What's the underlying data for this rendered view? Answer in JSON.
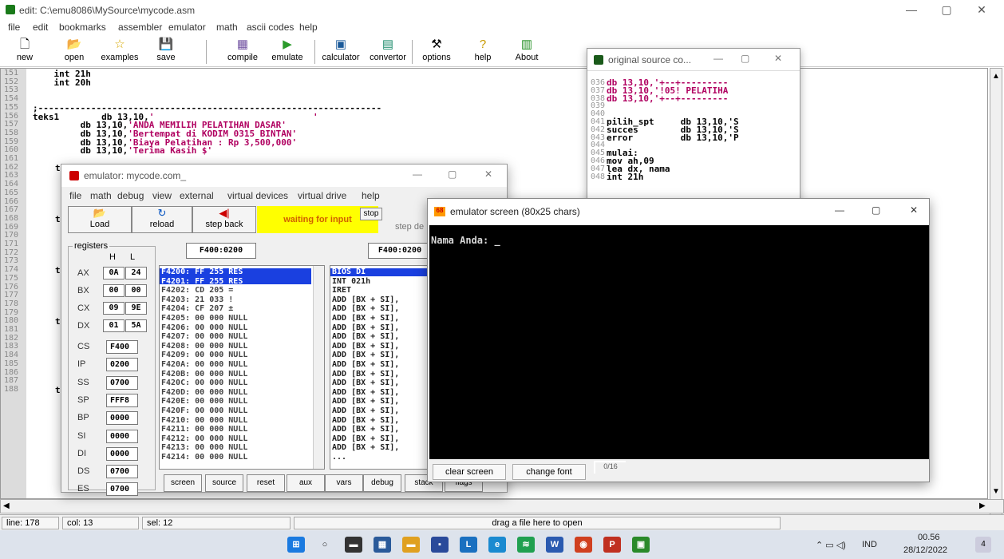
{
  "main_window": {
    "title": "edit: C:\\emu8086\\MySource\\mycode.asm",
    "controls": {
      "min": "—",
      "max": "▢",
      "close": "✕"
    }
  },
  "menu": [
    "file",
    "edit",
    "bookmarks",
    "assembler",
    "emulator",
    "math",
    "ascii codes",
    "help"
  ],
  "toolbar": [
    {
      "label": "new",
      "icon": "🗋"
    },
    {
      "label": "open",
      "icon": "📂"
    },
    {
      "label": "examples",
      "icon": "☆"
    },
    {
      "label": "save",
      "icon": "💾"
    },
    {
      "label": "compile",
      "icon": "▦"
    },
    {
      "label": "emulate",
      "icon": "▶"
    },
    {
      "label": "calculator",
      "icon": "▣"
    },
    {
      "label": "convertor",
      "icon": "▤"
    },
    {
      "label": "options",
      "icon": "⚒"
    },
    {
      "label": "help",
      "icon": "?"
    },
    {
      "label": "About",
      "icon": "▥"
    }
  ],
  "editor": {
    "line_numbers": [
      "151",
      "152",
      "153",
      "154",
      "155",
      "156",
      "157",
      "158",
      "159",
      "160",
      "161",
      "162",
      "163",
      "164",
      "165",
      "166",
      "167",
      "168",
      "169",
      "170",
      "171",
      "172",
      "173",
      "174",
      "175",
      "176",
      "177",
      "178",
      "179",
      "180",
      "181",
      "182",
      "183",
      "184",
      "185",
      "186",
      "187",
      "188"
    ],
    "lines": [
      {
        "text": "    int 21h",
        "str": ""
      },
      {
        "text": "    int 20h",
        "str": ""
      },
      {
        "text": "",
        "str": ""
      },
      {
        "text": "",
        "str": ""
      },
      {
        "text": ";-----------------------------------------------------------------",
        "str": ""
      },
      {
        "text": "teks1        db 13,10,",
        "str": "'                              '"
      },
      {
        "text": "         db 13,10,",
        "str": "'ANDA MEMILIH PELATIHAN DASAR'"
      },
      {
        "text": "         db 13,10,",
        "str": "'Bertempat di KODIM 0315 BINTAN'"
      },
      {
        "text": "         db 13,10,",
        "str": "'Biaya Pelatihan : Rp 3,500,000'"
      },
      {
        "text": "         db 13,10,",
        "str": "'Terima Kasih $'"
      }
    ],
    "left_chars": [
      "t",
      "t",
      "t",
      "t",
      "t",
      "e"
    ]
  },
  "statusbar": {
    "line": "line: 178",
    "col": "col: 13",
    "sel": "sel: 12",
    "hint": "drag a file here to open"
  },
  "taskbar": {
    "time": "00.56",
    "date": "28/12/2022",
    "lang": "IND",
    "notif": "4"
  },
  "source_window": {
    "title": "original source co...",
    "line_numbers": [
      "036",
      "037",
      "038",
      "039",
      "040",
      "041",
      "042",
      "043",
      "044",
      "045",
      "046",
      "047",
      "048"
    ],
    "lines": [
      "db 13,10,'+--+---------",
      "db 13,10,'!05! PELATIHA",
      "db 13,10,'+--+---------",
      "",
      "",
      "pilih_spt     db 13,10,'S",
      "succes        db 13,10,'S",
      "error         db 13,10,'P",
      "",
      "mulai:",
      "mov ah,09",
      "lea dx, nama",
      "int 21h"
    ]
  },
  "emulator": {
    "title": "emulator: mycode.com_",
    "menu": [
      "file",
      "math",
      "debug",
      "view",
      "external",
      "virtual devices",
      "virtual drive",
      "help"
    ],
    "buttons": {
      "load": "Load",
      "reload": "reload",
      "step_back": "step back",
      "status": "waiting for input",
      "stop": "stop",
      "step_delay": "step de"
    },
    "reg_label": "registers",
    "h": "H",
    "l": "L",
    "regs8": [
      {
        "n": "AX",
        "h": "0A",
        "l": "24"
      },
      {
        "n": "BX",
        "h": "00",
        "l": "00"
      },
      {
        "n": "CX",
        "h": "09",
        "l": "9E"
      },
      {
        "n": "DX",
        "h": "01",
        "l": "5A"
      }
    ],
    "regs16": [
      {
        "n": "CS",
        "v": "F400"
      },
      {
        "n": "IP",
        "v": "0200"
      },
      {
        "n": "SS",
        "v": "0700"
      },
      {
        "n": "SP",
        "v": "FFF8"
      },
      {
        "n": "BP",
        "v": "0000"
      },
      {
        "n": "SI",
        "v": "0000"
      },
      {
        "n": "DI",
        "v": "0000"
      },
      {
        "n": "DS",
        "v": "0700"
      },
      {
        "n": "ES",
        "v": "0700"
      }
    ],
    "addr1": "F400:0200",
    "addr2": "F400:0200",
    "mem": [
      "F4200: FF 255 RES",
      "F4201: FF 255 RES",
      "F4202: CD 205 =",
      "F4203: 21 033 !",
      "F4204: CF 207 ±",
      "F4205: 00 000 NULL",
      "F4206: 00 000 NULL",
      "F4207: 00 000 NULL",
      "F4208: 00 000 NULL",
      "F4209: 00 000 NULL",
      "F420A: 00 000 NULL",
      "F420B: 00 000 NULL",
      "F420C: 00 000 NULL",
      "F420D: 00 000 NULL",
      "F420E: 00 000 NULL",
      "F420F: 00 000 NULL",
      "F4210: 00 000 NULL",
      "F4211: 00 000 NULL",
      "F4212: 00 000 NULL",
      "F4213: 00 000 NULL",
      "F4214: 00 000 NULL"
    ],
    "dis": [
      "BIOS DI",
      "INT 021h",
      "IRET",
      "ADD [BX + SI],",
      "ADD [BX + SI],",
      "ADD [BX + SI],",
      "ADD [BX + SI],",
      "ADD [BX + SI],",
      "ADD [BX + SI],",
      "ADD [BX + SI],",
      "ADD [BX + SI],",
      "ADD [BX + SI],",
      "ADD [BX + SI],",
      "ADD [BX + SI],",
      "ADD [BX + SI],",
      "ADD [BX + SI],",
      "ADD [BX + SI],",
      "ADD [BX + SI],",
      "ADD [BX + SI],",
      "ADD [BX + SI],",
      "..."
    ],
    "bottom": [
      "screen",
      "source",
      "reset",
      "aux",
      "vars",
      "debug",
      "stack",
      "flags"
    ]
  },
  "screen_window": {
    "title": "emulator screen (80x25 chars)",
    "text": "Nama Anda: _",
    "clear": "clear screen",
    "font": "change font",
    "counter": "0/16"
  }
}
